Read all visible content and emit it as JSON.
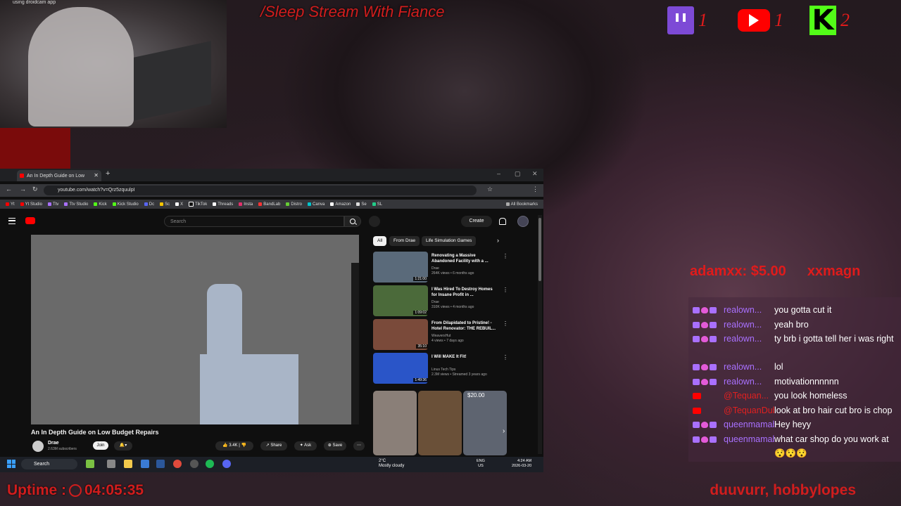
{
  "overlay": {
    "title": "/Sleep Stream With Fiance",
    "cam_caption": "using droidcam app",
    "platforms": [
      {
        "name": "twitch",
        "count": "1"
      },
      {
        "name": "youtube",
        "count": "1"
      },
      {
        "name": "kick",
        "count": "2"
      }
    ],
    "ticker": [
      "adamxx: $5.00",
      "xxmagn"
    ],
    "uptime_label": "Uptime :",
    "uptime_value": "04:05:35",
    "followers": "duuvurr, hobbylopes",
    "colors": {
      "accent": "#d11d1d",
      "twitch": "#a970ff",
      "kick": "#53fc18",
      "youtube": "#ff0000"
    }
  },
  "chat": [
    {
      "platform": "twitch",
      "user": "realown...",
      "msg": "you gotta cut it"
    },
    {
      "platform": "twitch",
      "user": "realown...",
      "msg": "yeah bro"
    },
    {
      "platform": "twitch",
      "user": "realown...",
      "msg": "ty brb i gotta tell her i was right"
    },
    {
      "platform": "twitch",
      "user": "realown...",
      "msg": "lol"
    },
    {
      "platform": "twitch",
      "user": "realown...",
      "msg": "motivationnnnnn"
    },
    {
      "platform": "youtube",
      "user": "@Tequan...",
      "msg": "you look homeless"
    },
    {
      "platform": "youtube",
      "user": "@TequanDubi...",
      "msg": "look at bro hair cut bro is chop"
    },
    {
      "platform": "twitch",
      "user": "queenmamab...",
      "msg": "Hey heyy"
    },
    {
      "platform": "twitch",
      "user": "queenmamab...",
      "msg": "what car shop do you work at 😯😯😯"
    }
  ],
  "browser": {
    "tab_title": "An In Depth Guide on Low",
    "url": "youtube.com/watch?v=Qrz5zquulpI",
    "bookmarks": [
      "Yt",
      "Yt Studio",
      "Ttv",
      "Ttv Studio",
      "Kick",
      "Kick Studio",
      "Dc",
      "Sc",
      "X",
      "TikTok",
      "Threads",
      "Insta",
      "BandLab",
      "Distro",
      "Canva",
      "Amazon",
      "Se",
      "SL"
    ],
    "all_bookmarks": "All Bookmarks"
  },
  "youtube": {
    "search_placeholder": "Search",
    "create": "Create",
    "video_title": "An In Depth Guide on Low Budget Repairs",
    "channel": "Drae",
    "subs": "2.63M subscribers",
    "join": "Join",
    "likes": "3.4K",
    "share": "Share",
    "ask": "Ask",
    "save": "Save",
    "chips": [
      "All",
      "From Drae",
      "Life Simulation Games"
    ],
    "related": [
      {
        "title": "Renovating a Massive Abandoned Facility with a ...",
        "channel": "Drae",
        "meta": "264K views • 6 months ago",
        "duration": "1:21:00",
        "thumb": "#5a6a7a"
      },
      {
        "title": "I Was Hired To Destroy Homes for Insane Profit in ...",
        "channel": "Drae",
        "meta": "310K views • 4 months ago",
        "duration": "1:09:02",
        "thumb": "#4b6a3a"
      },
      {
        "title": "From Dilapidated to Pristine! - Hotel Renovator: THE REBUIL...",
        "channel": "WeaversHut",
        "meta": "4 views • 7 days ago",
        "duration": "35:10",
        "thumb": "#7a4a3a"
      },
      {
        "title": "I Will MAKE It Fit!",
        "channel": "Linus Tech Tips",
        "meta": "2.3M views • Streamed 3 years ago",
        "duration": "1:49:36",
        "thumb": "#2a55c8"
      }
    ],
    "short_price": "$20.00"
  },
  "taskbar": {
    "search": "Search",
    "weather_temp": "2°C",
    "weather_desc": "Mostly cloudy",
    "lang1": "ENG",
    "lang2": "US",
    "time": "4:24 AM",
    "date": "2026-03-20"
  }
}
